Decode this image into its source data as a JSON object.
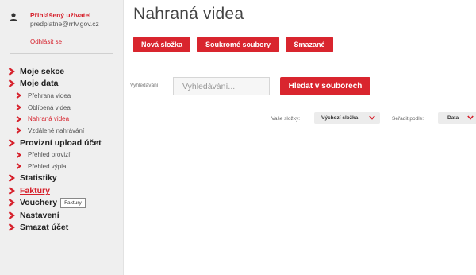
{
  "user": {
    "title": "Přihlášený uživatel",
    "email": "predplatne@rrtv.gov.cz",
    "logout": "Odhlásit se"
  },
  "nav": {
    "items": [
      {
        "label": "Moje sekce",
        "level": "top"
      },
      {
        "label": "Moje data",
        "level": "top"
      },
      {
        "label": "Přehrana videa",
        "level": "sub"
      },
      {
        "label": "Oblíbená videa",
        "level": "sub"
      },
      {
        "label": "Nahraná videa",
        "level": "sub",
        "active": true
      },
      {
        "label": "Vzdálené nahrávání",
        "level": "sub"
      },
      {
        "label": "Provizní upload účet",
        "level": "top"
      },
      {
        "label": "Přehled provizí",
        "level": "sub"
      },
      {
        "label": "Přehled výplat",
        "level": "sub"
      },
      {
        "label": "Statistiky",
        "level": "top"
      },
      {
        "label": "Faktury",
        "level": "top",
        "active": true
      },
      {
        "label": "Vouchery",
        "level": "top",
        "tooltip": "Faktury"
      },
      {
        "label": "Nastavení",
        "level": "top"
      },
      {
        "label": "Smazat účet",
        "level": "top"
      }
    ]
  },
  "main": {
    "title": "Nahraná videa",
    "buttons": {
      "new_folder": "Nová složka",
      "private_files": "Soukromé soubory",
      "deleted": "Smazané"
    },
    "search": {
      "label": "Vyhledávání",
      "placeholder": "Vyhledávání...",
      "button": "Hledat v souborech"
    },
    "filters": {
      "folders_label": "Vaše složky:",
      "folders_value": "Výchozí složka",
      "sort_label": "Seřadit podle:",
      "sort_value": "Data"
    }
  },
  "colors": {
    "accent": "#d9252e",
    "sidebar_bg": "#efefef"
  },
  "icons": {
    "user": "user-icon",
    "chevron": "chevron-right-icon",
    "caret": "chevron-down-icon"
  }
}
